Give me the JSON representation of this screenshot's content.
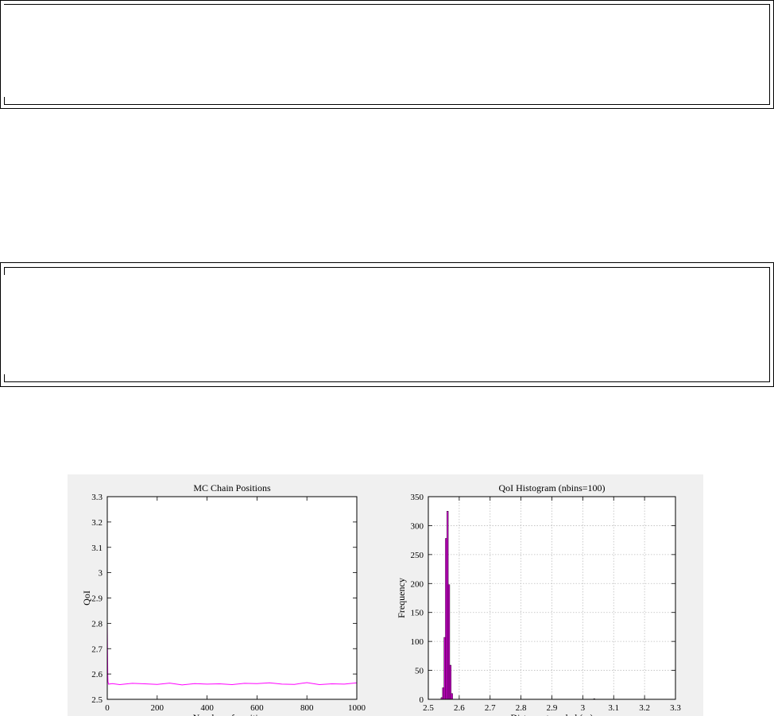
{
  "chart_data": [
    {
      "type": "line",
      "title": "MC Chain Positions",
      "xlabel": "Number of positions",
      "ylabel": "QoI",
      "xlim": [
        0,
        1000
      ],
      "ylim": [
        2.5,
        3.3
      ],
      "xticks": [
        0,
        200,
        400,
        600,
        800,
        1000
      ],
      "yticks": [
        2.5,
        2.6,
        2.7,
        2.8,
        2.9,
        3,
        3.1,
        3.2,
        3.3
      ],
      "xtick_labels": [
        "0",
        "200",
        "400",
        "600",
        "800",
        "1000"
      ],
      "ytick_labels": [
        "2.5",
        "2.6",
        "2.7",
        "2.8",
        "2.9",
        "3",
        "3.1",
        "3.2",
        "3.3"
      ],
      "grid": false,
      "color": "#ff00ff",
      "series": [
        {
          "x": [
            0,
            1,
            2,
            3,
            4,
            5,
            20,
            50,
            100,
            150,
            200,
            250,
            300,
            350,
            400,
            450,
            500,
            550,
            600,
            650,
            700,
            750,
            800,
            850,
            900,
            950,
            1000
          ],
          "y": [
            2.8,
            2.7,
            2.6,
            2.57,
            2.565,
            2.56,
            2.562,
            2.558,
            2.563,
            2.561,
            2.559,
            2.564,
            2.557,
            2.562,
            2.56,
            2.561,
            2.558,
            2.563,
            2.562,
            2.565,
            2.56,
            2.559,
            2.566,
            2.558,
            2.561,
            2.56,
            2.565
          ]
        }
      ]
    },
    {
      "type": "bar",
      "title": "QoI Histogram (nbins=100)",
      "xlabel": "Distance traveled (m)",
      "ylabel": "Frequency",
      "xlim": [
        2.5,
        3.3
      ],
      "ylim": [
        0,
        350
      ],
      "xticks": [
        2.5,
        2.6,
        2.7,
        2.8,
        2.9,
        3,
        3.1,
        3.2,
        3.3
      ],
      "yticks": [
        0,
        50,
        100,
        150,
        200,
        250,
        300,
        350
      ],
      "xtick_labels": [
        "2.5",
        "2.6",
        "2.7",
        "2.8",
        "2.9",
        "3",
        "3.1",
        "3.2",
        "3.3"
      ],
      "ytick_labels": [
        "0",
        "50",
        "100",
        "150",
        "200",
        "250",
        "300",
        "350"
      ],
      "grid": true,
      "color": "#cc00cc",
      "bin_width": 0.00475,
      "bins": [
        {
          "x": 2.5433,
          "y": 3
        },
        {
          "x": 2.548,
          "y": 20
        },
        {
          "x": 2.5528,
          "y": 107
        },
        {
          "x": 2.5575,
          "y": 278
        },
        {
          "x": 2.5623,
          "y": 325
        },
        {
          "x": 2.567,
          "y": 198
        },
        {
          "x": 2.5718,
          "y": 59
        },
        {
          "x": 2.5765,
          "y": 10
        },
        {
          "x": 3.0372,
          "y": 1
        }
      ]
    }
  ]
}
